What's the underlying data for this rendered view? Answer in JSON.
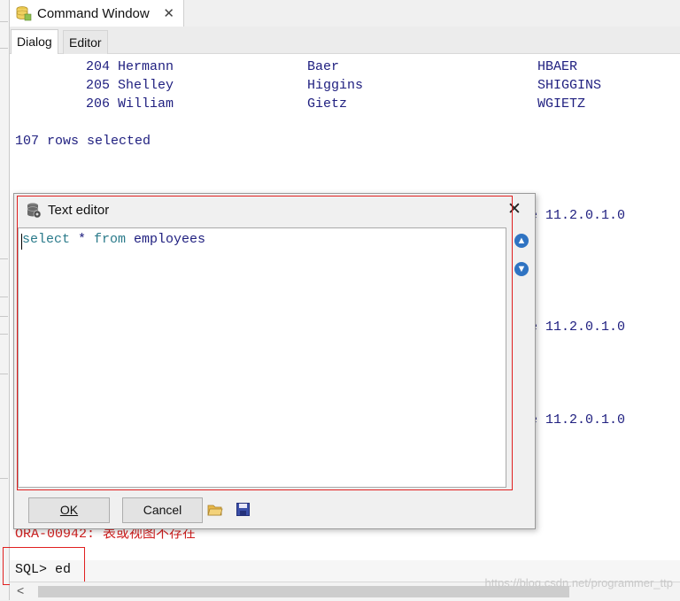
{
  "window_tab": {
    "title": "Command Window",
    "close_glyph": "✕"
  },
  "subtabs": [
    {
      "label": "Dialog"
    },
    {
      "label": "Editor"
    }
  ],
  "console": {
    "rows": [
      {
        "id": "204",
        "first": "Hermann",
        "last": "Baer",
        "email": "HBAER"
      },
      {
        "id": "205",
        "first": "Shelley",
        "last": "Higgins",
        "email": "SHIGGINS"
      },
      {
        "id": "206",
        "first": "William",
        "last": "Gietz",
        "email": "WGIETZ"
      }
    ],
    "rows_selected": "107 rows selected",
    "version_fragments": [
      "e 11.2.0.1.0",
      "e 11.2.0.1.0",
      "e 11.2.0.1.0"
    ],
    "error_line": "ORA-00942: 表或视图不存在",
    "prompt": "SQL> ed"
  },
  "dialog": {
    "title": "Text editor",
    "close_glyph": "✕",
    "editor_text": {
      "kw1": "select",
      "star": " * ",
      "kw2": "from",
      "rest": " employees"
    },
    "ok_label": "OK",
    "cancel_label": "Cancel",
    "up_glyph": "▲",
    "down_glyph": "▼"
  },
  "scrollbar": {
    "left_arrow": "<"
  },
  "watermark": "https://blog.csdn.net/programmer_ttp",
  "colors": {
    "console_text": "#202080",
    "error": "#d02020",
    "highlight": "#e02020",
    "keyword": "#2a7a8a"
  }
}
